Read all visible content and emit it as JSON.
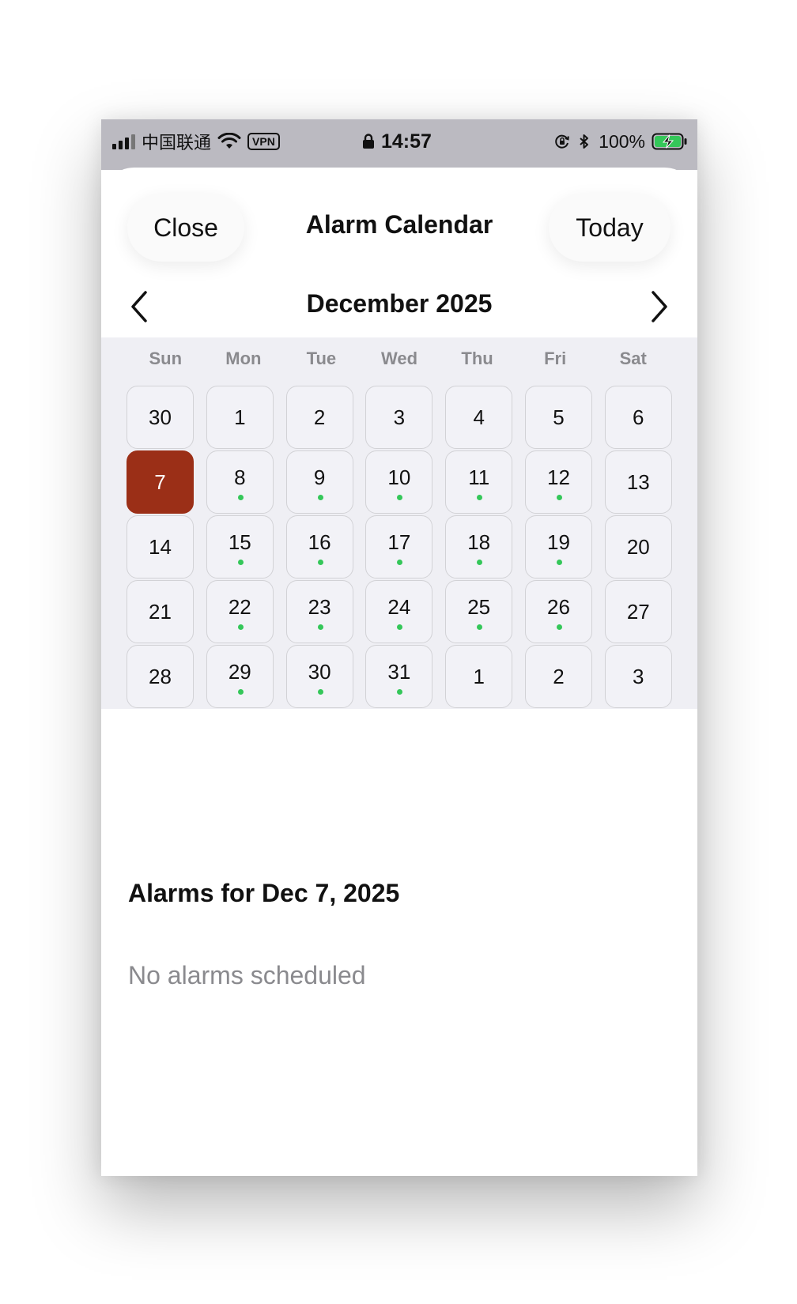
{
  "status_bar": {
    "carrier": "中国联通",
    "vpn": "VPN",
    "time": "14:57",
    "battery": "100%"
  },
  "sheet": {
    "close_label": "Close",
    "title": "Alarm Calendar",
    "today_label": "Today"
  },
  "month": {
    "title": "December 2025"
  },
  "weekdays": [
    "Sun",
    "Mon",
    "Tue",
    "Wed",
    "Thu",
    "Fri",
    "Sat"
  ],
  "days": [
    {
      "n": "30",
      "dot": false,
      "selected": false
    },
    {
      "n": "1",
      "dot": false,
      "selected": false
    },
    {
      "n": "2",
      "dot": false,
      "selected": false
    },
    {
      "n": "3",
      "dot": false,
      "selected": false
    },
    {
      "n": "4",
      "dot": false,
      "selected": false
    },
    {
      "n": "5",
      "dot": false,
      "selected": false
    },
    {
      "n": "6",
      "dot": false,
      "selected": false
    },
    {
      "n": "7",
      "dot": false,
      "selected": true
    },
    {
      "n": "8",
      "dot": true,
      "selected": false
    },
    {
      "n": "9",
      "dot": true,
      "selected": false
    },
    {
      "n": "10",
      "dot": true,
      "selected": false
    },
    {
      "n": "11",
      "dot": true,
      "selected": false
    },
    {
      "n": "12",
      "dot": true,
      "selected": false
    },
    {
      "n": "13",
      "dot": false,
      "selected": false
    },
    {
      "n": "14",
      "dot": false,
      "selected": false
    },
    {
      "n": "15",
      "dot": true,
      "selected": false
    },
    {
      "n": "16",
      "dot": true,
      "selected": false
    },
    {
      "n": "17",
      "dot": true,
      "selected": false
    },
    {
      "n": "18",
      "dot": true,
      "selected": false
    },
    {
      "n": "19",
      "dot": true,
      "selected": false
    },
    {
      "n": "20",
      "dot": false,
      "selected": false
    },
    {
      "n": "21",
      "dot": false,
      "selected": false
    },
    {
      "n": "22",
      "dot": true,
      "selected": false
    },
    {
      "n": "23",
      "dot": true,
      "selected": false
    },
    {
      "n": "24",
      "dot": true,
      "selected": false
    },
    {
      "n": "25",
      "dot": true,
      "selected": false
    },
    {
      "n": "26",
      "dot": true,
      "selected": false
    },
    {
      "n": "27",
      "dot": false,
      "selected": false
    },
    {
      "n": "28",
      "dot": false,
      "selected": false
    },
    {
      "n": "29",
      "dot": true,
      "selected": false
    },
    {
      "n": "30",
      "dot": true,
      "selected": false
    },
    {
      "n": "31",
      "dot": true,
      "selected": false
    },
    {
      "n": "1",
      "dot": false,
      "selected": false
    },
    {
      "n": "2",
      "dot": false,
      "selected": false
    },
    {
      "n": "3",
      "dot": false,
      "selected": false
    }
  ],
  "alarms": {
    "title": "Alarms for Dec 7, 2025",
    "empty": "No alarms scheduled"
  },
  "colors": {
    "selected": "#9b2f17",
    "dot": "#34c759",
    "status_bar": "#bbbac1"
  },
  "icons": [
    "signal-icon",
    "wifi-icon",
    "lock-icon",
    "orientation-lock-icon",
    "bluetooth-icon",
    "battery-charging-icon",
    "chevron-left-icon",
    "chevron-right-icon"
  ]
}
